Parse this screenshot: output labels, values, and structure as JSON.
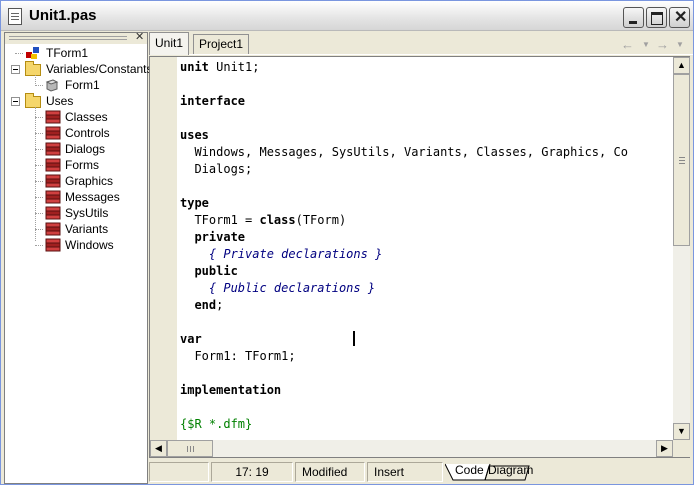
{
  "window": {
    "title": "Unit1.pas"
  },
  "tree": {
    "root": "TForm1",
    "variables_label": "Variables/Constants",
    "variables": [
      "Form1"
    ],
    "uses_label": "Uses",
    "uses": [
      "Classes",
      "Controls",
      "Dialogs",
      "Forms",
      "Graphics",
      "Messages",
      "SysUtils",
      "Variants",
      "Windows"
    ]
  },
  "tabs": [
    {
      "label": "Unit1",
      "active": true
    },
    {
      "label": "Project1",
      "active": false
    }
  ],
  "code": {
    "lines": [
      [
        {
          "t": "unit",
          "c": "kw"
        },
        {
          "t": " Unit1;"
        }
      ],
      [],
      [
        {
          "t": "interface",
          "c": "kw"
        }
      ],
      [],
      [
        {
          "t": "uses",
          "c": "kw"
        }
      ],
      [
        {
          "t": "  Windows, Messages, SysUtils, Variants, Classes, Graphics, Co"
        }
      ],
      [
        {
          "t": "  Dialogs;"
        }
      ],
      [],
      [
        {
          "t": "type",
          "c": "kw"
        }
      ],
      [
        {
          "t": "  TForm1 = "
        },
        {
          "t": "class",
          "c": "kw"
        },
        {
          "t": "(TForm)"
        }
      ],
      [
        {
          "t": "  "
        },
        {
          "t": "private",
          "c": "kw"
        }
      ],
      [
        {
          "t": "    "
        },
        {
          "t": "{ Private declarations }",
          "c": "cm"
        }
      ],
      [
        {
          "t": "  "
        },
        {
          "t": "public",
          "c": "kw"
        }
      ],
      [
        {
          "t": "    "
        },
        {
          "t": "{ Public declarations }",
          "c": "cm"
        }
      ],
      [
        {
          "t": "  "
        },
        {
          "t": "end",
          "c": "kw"
        },
        {
          "t": ";"
        }
      ],
      [],
      [
        {
          "t": "var",
          "c": "kw"
        }
      ],
      [
        {
          "t": "  Form1: TForm1;"
        }
      ],
      [],
      [
        {
          "t": "implementation",
          "c": "kw"
        }
      ],
      [],
      [
        {
          "t": "{$R *.dfm}",
          "c": "dir"
        }
      ]
    ]
  },
  "status": {
    "position": "17: 19",
    "modified": "Modified",
    "mode": "Insert",
    "bottom_tabs": [
      {
        "label": "Code",
        "active": true
      },
      {
        "label": "Diagram",
        "active": false
      }
    ]
  },
  "icons": {
    "title": "document-icon",
    "nav_back": "←",
    "nav_forward": "→",
    "scroll_up": "▲",
    "scroll_down": "▼",
    "scroll_left": "◀",
    "scroll_right": "▶",
    "pane_close": "✕"
  },
  "colors": {
    "keyword": "#000000",
    "comment": "#000080",
    "directive": "#008000",
    "folder": "#f5d66b",
    "unit_icon": "#b22222"
  }
}
